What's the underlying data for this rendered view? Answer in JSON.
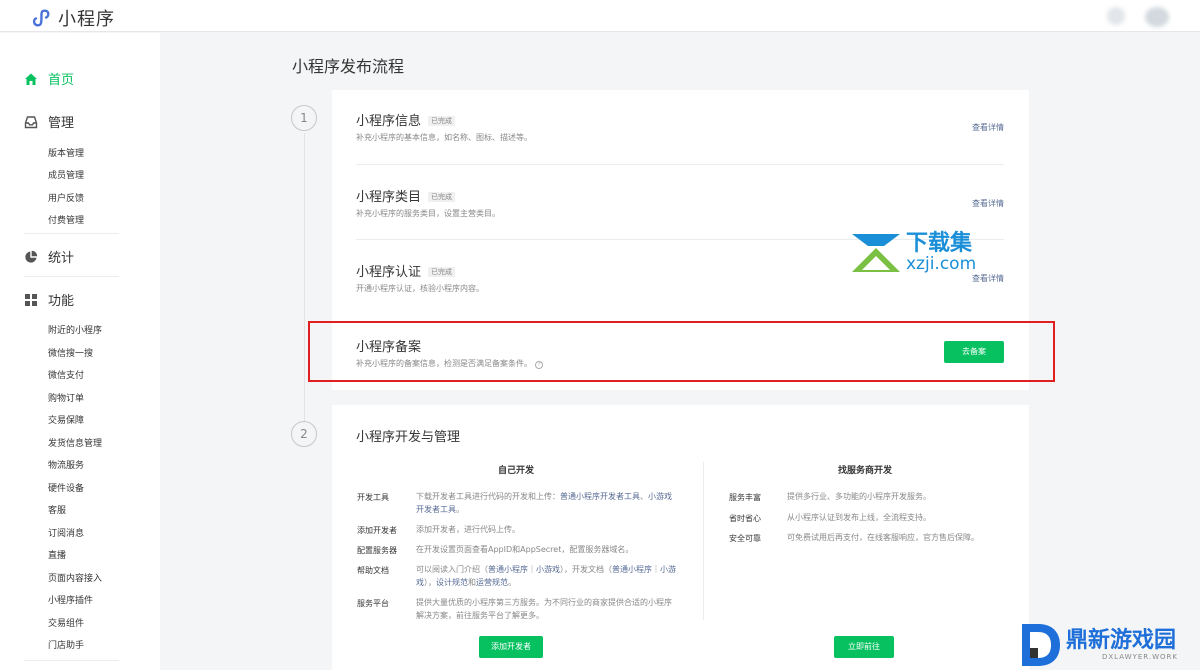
{
  "app": {
    "title": "小程序"
  },
  "sidebar": {
    "home": "首页",
    "manage": {
      "label": "管理",
      "items": [
        "版本管理",
        "成员管理",
        "用户反馈",
        "付费管理"
      ]
    },
    "stats": "统计",
    "features": {
      "label": "功能",
      "items": [
        "附近的小程序",
        "微信搜一搜",
        "微信支付",
        "购物订单",
        "交易保障",
        "发货信息管理",
        "物流服务",
        "硬件设备",
        "客服",
        "订阅消息",
        "直播",
        "页面内容接入",
        "小程序插件",
        "交易组件",
        "门店助手"
      ]
    }
  },
  "main": {
    "title": "小程序发布流程",
    "step1": {
      "number": "1",
      "rows": [
        {
          "title": "小程序信息",
          "badge": "已完成",
          "desc": "补充小程序的基本信息，如名称、图标、描述等。",
          "link": "查看详情"
        },
        {
          "title": "小程序类目",
          "badge": "已完成",
          "desc": "补充小程序的服务类目，设置主营类目。",
          "link": "查看详情"
        },
        {
          "title": "小程序认证",
          "badge": "已完成",
          "desc": "开通小程序认证，核验小程序内容。",
          "link": "查看详情"
        },
        {
          "title": "小程序备案",
          "desc": "补充小程序的备案信息，检测是否满足备案条件。",
          "button": "去备案"
        }
      ]
    },
    "step2": {
      "number": "2",
      "title": "小程序开发与管理",
      "self_dev": {
        "title": "自己开发",
        "items": [
          {
            "key": "开发工具",
            "value_pre": "下载开发者工具进行代码的开发和上传：",
            "link1": "普通小程序开发者工具",
            "mid": "、",
            "link2": "小游戏开发者工具",
            "post": "。"
          },
          {
            "key": "添加开发者",
            "value": "添加开发者，进行代码上传。"
          },
          {
            "key": "配置服务器",
            "value": "在开发设置页面查看AppID和AppSecret，配置服务器域名。"
          },
          {
            "key": "帮助文档",
            "value_pre": "可以阅读入门介绍（",
            "link1": "普通小程序",
            "mid1": "｜",
            "link2": "小游戏",
            "mid2": "），开发文档（",
            "link3": "普通小程序",
            "mid3": "｜",
            "link4": "小游戏",
            "mid4": "），",
            "link5": "设计规范",
            "mid5": "和",
            "link6": "运营规范",
            "post": "。"
          },
          {
            "key": "服务平台",
            "value": "提供大量优质的小程序第三方服务。为不同行业的商家提供合适的小程序解决方案，前往服务平台了解更多。"
          }
        ],
        "button": "添加开发者"
      },
      "provider_dev": {
        "title": "找服务商开发",
        "items": [
          {
            "key": "服务丰富",
            "value": "提供多行业、多功能的小程序开发服务。"
          },
          {
            "key": "省时省心",
            "value": "从小程序认证到发布上线，全流程支持。"
          },
          {
            "key": "安全可靠",
            "value": "可免费试用后再支付，在线客服响应，官方售后保障。"
          }
        ],
        "button": "立即前往"
      }
    }
  },
  "watermarks": {
    "xzji_cn": "下载集",
    "xzji_url": "xzji.com",
    "dx_cn": "鼎新游戏园",
    "dx_en": "DXLAWYER.WORK"
  },
  "colors": {
    "accent": "#07c160",
    "link": "#576b95",
    "highlight": "#e02020"
  }
}
